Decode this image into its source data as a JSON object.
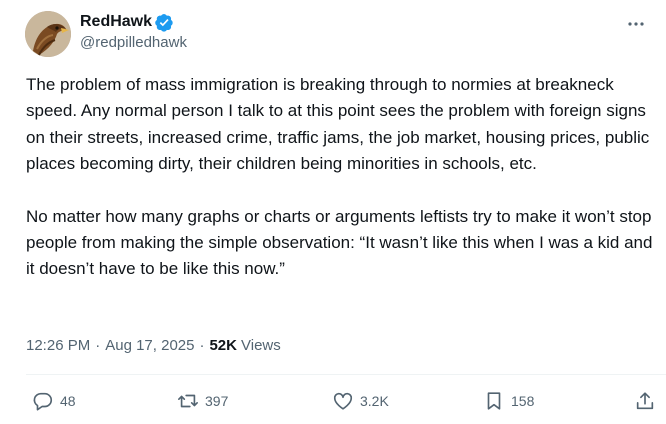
{
  "author": {
    "display_name": "RedHawk",
    "handle": "@redpilledhawk",
    "verified": true,
    "avatar_icon": "hawk-avatar"
  },
  "tweet": {
    "paragraphs": [
      "The problem of mass immigration is breaking through to normies at breakneck speed. Any normal person I talk to at this point sees the problem with foreign signs on their streets, increased crime, traffic jams, the job market, housing prices, public places becoming dirty, their children being minorities in schools, etc.",
      "No matter how many graphs or charts or arguments leftists try to make it won’t stop people from making the simple observation: “It wasn’t like this when I was a kid and it doesn’t have to be like this now.”"
    ]
  },
  "meta": {
    "time": "12:26 PM",
    "separator": "·",
    "date": "Aug 17, 2025",
    "views_count": "52K",
    "views_label": "Views"
  },
  "actions": {
    "replies": {
      "icon": "reply-icon",
      "count": "48"
    },
    "reposts": {
      "icon": "repost-icon",
      "count": "397"
    },
    "likes": {
      "icon": "like-icon",
      "count": "3.2K"
    },
    "bookmarks": {
      "icon": "bookmark-icon",
      "count": "158"
    },
    "share": {
      "icon": "share-icon"
    }
  },
  "colors": {
    "verified_badge": "#1d9bf0",
    "secondary_text": "#536471",
    "primary_text": "#0f1419"
  }
}
